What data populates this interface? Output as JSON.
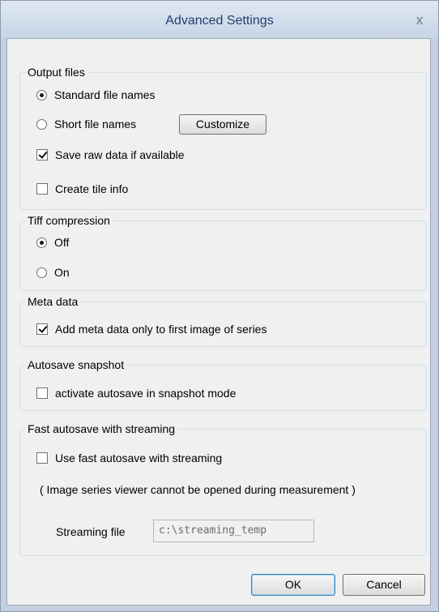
{
  "window": {
    "title": "Advanced Settings",
    "close_glyph": "x"
  },
  "output_files": {
    "legend": "Output files",
    "standard_label": "Standard file names",
    "short_label": "Short file names",
    "customize_label": "Customize",
    "save_raw_label": "Save raw data if available",
    "tile_info_label": "Create tile info",
    "selected": "standard",
    "save_raw_checked": true,
    "tile_info_checked": false
  },
  "tiff": {
    "legend": "Tiff compression",
    "off_label": "Off",
    "on_label": "On",
    "selected": "off"
  },
  "meta": {
    "legend": "Meta data",
    "first_image_label": "Add meta data only to first image of series",
    "first_image_checked": true
  },
  "autosave": {
    "legend": "Autosave snapshot",
    "activate_label": "activate autosave in snapshot mode",
    "activate_checked": false
  },
  "fast": {
    "legend": "Fast autosave with streaming",
    "use_label": "Use fast autosave with streaming",
    "use_checked": false,
    "note": "( Image series viewer cannot be opened during measurement )",
    "streaming_label": "Streaming file",
    "streaming_value": "c:\\streaming_temp"
  },
  "buttons": {
    "ok": "OK",
    "cancel": "Cancel"
  },
  "icons": {
    "close": "close-icon"
  }
}
